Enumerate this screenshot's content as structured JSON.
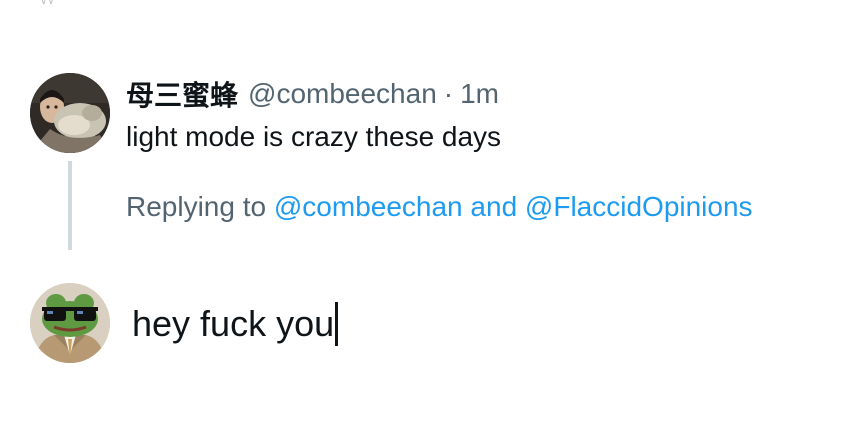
{
  "tweet": {
    "display_name": "母三蜜蜂",
    "handle": "@combeechan",
    "separator": "·",
    "time": "1m",
    "text": "light mode is crazy these days"
  },
  "reply_context": {
    "prefix": "Replying to ",
    "mention_1": "@combeechan",
    "conjunction": " and ",
    "mention_2": "@FlaccidOpinions"
  },
  "composer": {
    "value": "hey fuck you"
  },
  "colors": {
    "text_primary": "#0f1419",
    "text_secondary": "#536471",
    "link": "#1d9bf0",
    "thread_line": "#cfd9de"
  },
  "icons": {
    "author_avatar": "author-avatar-photo",
    "user_avatar": "frog-sunglasses-avatar"
  }
}
